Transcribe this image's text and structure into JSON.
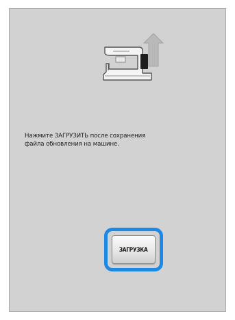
{
  "screen": {
    "icon": "sewing-machine-update-icon",
    "message": "Нажмите ЗАГРУЗИТЬ после сохранения\nфайла обновления на машине."
  },
  "load_button": {
    "label": "ЗАГРУЗКА"
  },
  "colors": {
    "panel_background": "#d2d2d2",
    "highlight_border": "#1e88e5",
    "arrow": "#b9b9b9"
  }
}
